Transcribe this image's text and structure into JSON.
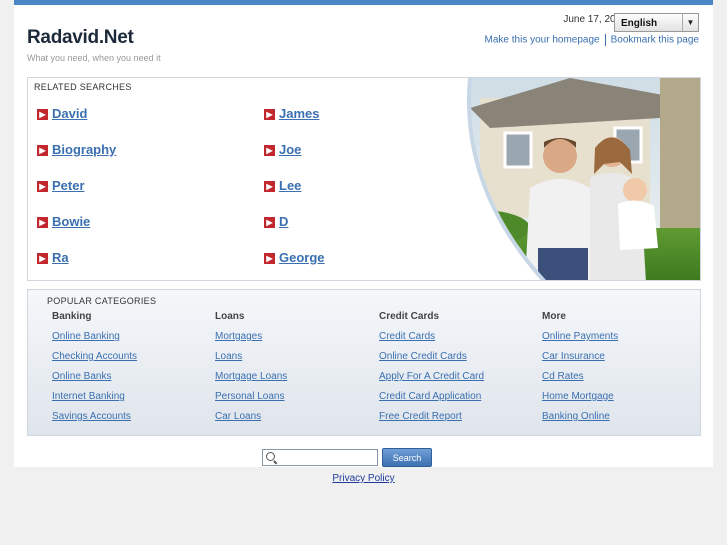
{
  "header": {
    "date": "June 17, 2011",
    "language": "English",
    "site_title": "Radavid.Net",
    "tagline": "What you need, when you need it",
    "links": {
      "homepage": "Make this your homepage",
      "bookmark": "Bookmark this page"
    }
  },
  "related": {
    "title": "RELATED SEARCHES",
    "items": [
      "David",
      "James",
      "Biography",
      "Joe",
      "Peter",
      "Lee",
      "Bowie",
      "D",
      "Ra",
      "George"
    ]
  },
  "popular": {
    "title": "POPULAR CATEGORIES",
    "columns": [
      {
        "heading": "Banking",
        "links": [
          "Online Banking",
          "Checking Accounts",
          "Online Banks",
          "Internet Banking",
          "Savings Accounts"
        ]
      },
      {
        "heading": "Loans",
        "links": [
          "Mortgages",
          "Loans",
          "Mortgage Loans",
          "Personal Loans",
          "Car Loans"
        ]
      },
      {
        "heading": "Credit Cards",
        "links": [
          "Credit Cards",
          "Online Credit Cards",
          "Apply For A Credit Card",
          "Credit Card Application",
          "Free Credit Report"
        ]
      },
      {
        "heading": "More",
        "links": [
          "Online Payments",
          "Car Insurance",
          "Cd Rates",
          "Home Mortgage",
          "Banking Online"
        ]
      }
    ]
  },
  "search": {
    "value": "",
    "button": "Search"
  },
  "footer": {
    "privacy": "Privacy Policy"
  },
  "colors": {
    "accent": "#3a6fb0",
    "bullet": "#c1272d",
    "topbar": "#4a86c5"
  }
}
